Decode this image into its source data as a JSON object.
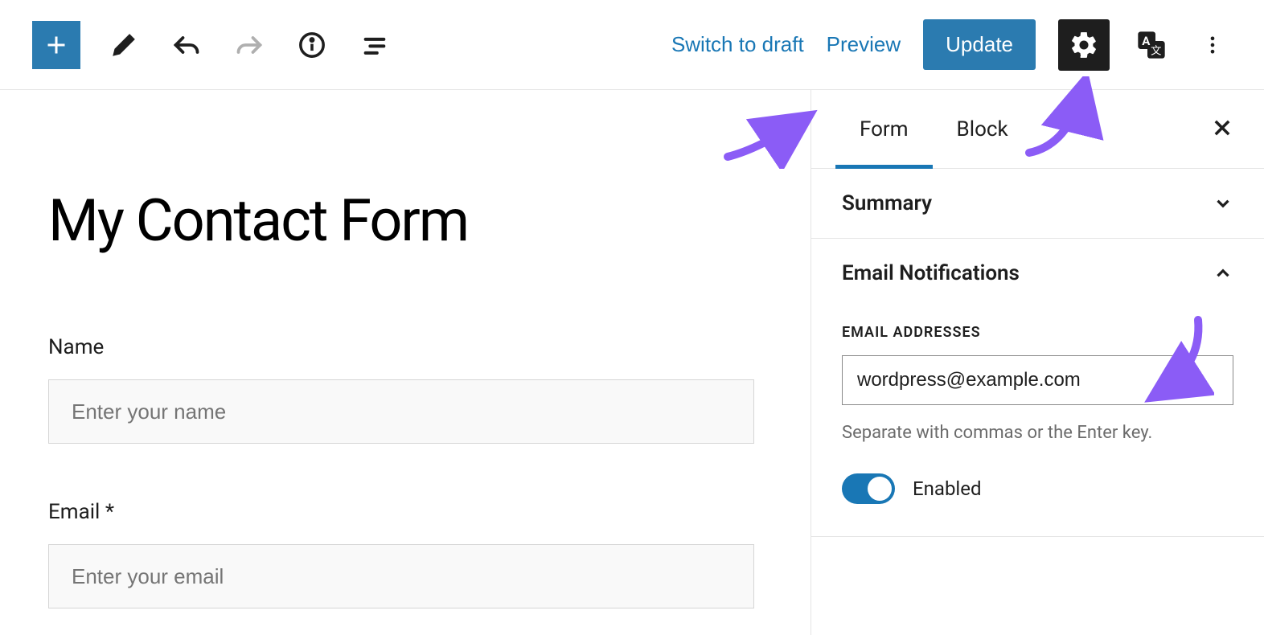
{
  "toolbar": {
    "switch_to_draft": "Switch to draft",
    "preview": "Preview",
    "update": "Update"
  },
  "editor": {
    "title": "My Contact Form",
    "fields": {
      "name_label": "Name",
      "name_placeholder": "Enter your name",
      "email_label": "Email *",
      "email_placeholder": "Enter your email"
    }
  },
  "sidebar": {
    "tabs": {
      "form": "Form",
      "block": "Block"
    },
    "panels": {
      "summary": "Summary",
      "email_notifications": "Email Notifications"
    },
    "email": {
      "heading": "EMAIL ADDRESSES",
      "value": "wordpress@example.com",
      "help": "Separate with commas or the Enter key.",
      "toggle_label": "Enabled"
    }
  }
}
